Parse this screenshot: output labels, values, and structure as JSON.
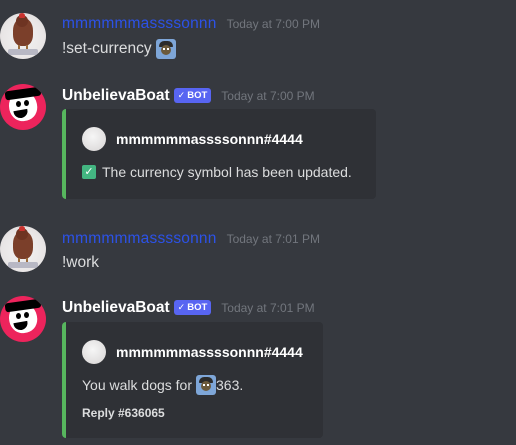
{
  "messages": [
    {
      "author": "mmmmmmassssonnn",
      "timestamp": "Today at 7:00 PM",
      "content": "!set-currency",
      "emoji": "currency-emoji"
    },
    {
      "author": "UnbelievaBoat",
      "bot_tag": "BOT",
      "timestamp": "Today at 7:00 PM",
      "embed": {
        "author": "mmmmmmassssonnn#4444",
        "description": "The currency symbol has been updated.",
        "description_icon": "check-mark-icon",
        "accent_color": "#57b65e"
      }
    },
    {
      "author": "mmmmmmassssonnn",
      "timestamp": "Today at 7:01 PM",
      "content": "!work"
    },
    {
      "author": "UnbelievaBoat",
      "bot_tag": "BOT",
      "timestamp": "Today at 7:01 PM",
      "embed": {
        "author": "mmmmmmassssonnn#4444",
        "description_before": "You walk dogs for",
        "description_after": "363.",
        "footer": "Reply #636065",
        "accent_color": "#57b65e"
      }
    }
  ],
  "colors": {
    "background": "#36393f",
    "user_name": "#2c52e8",
    "bot_name": "#ffffff",
    "bot_tag": "#5865f2",
    "embed_bg": "#2f3136",
    "embed_accent": "#57b65e",
    "bot_avatar": "#ed245c"
  }
}
